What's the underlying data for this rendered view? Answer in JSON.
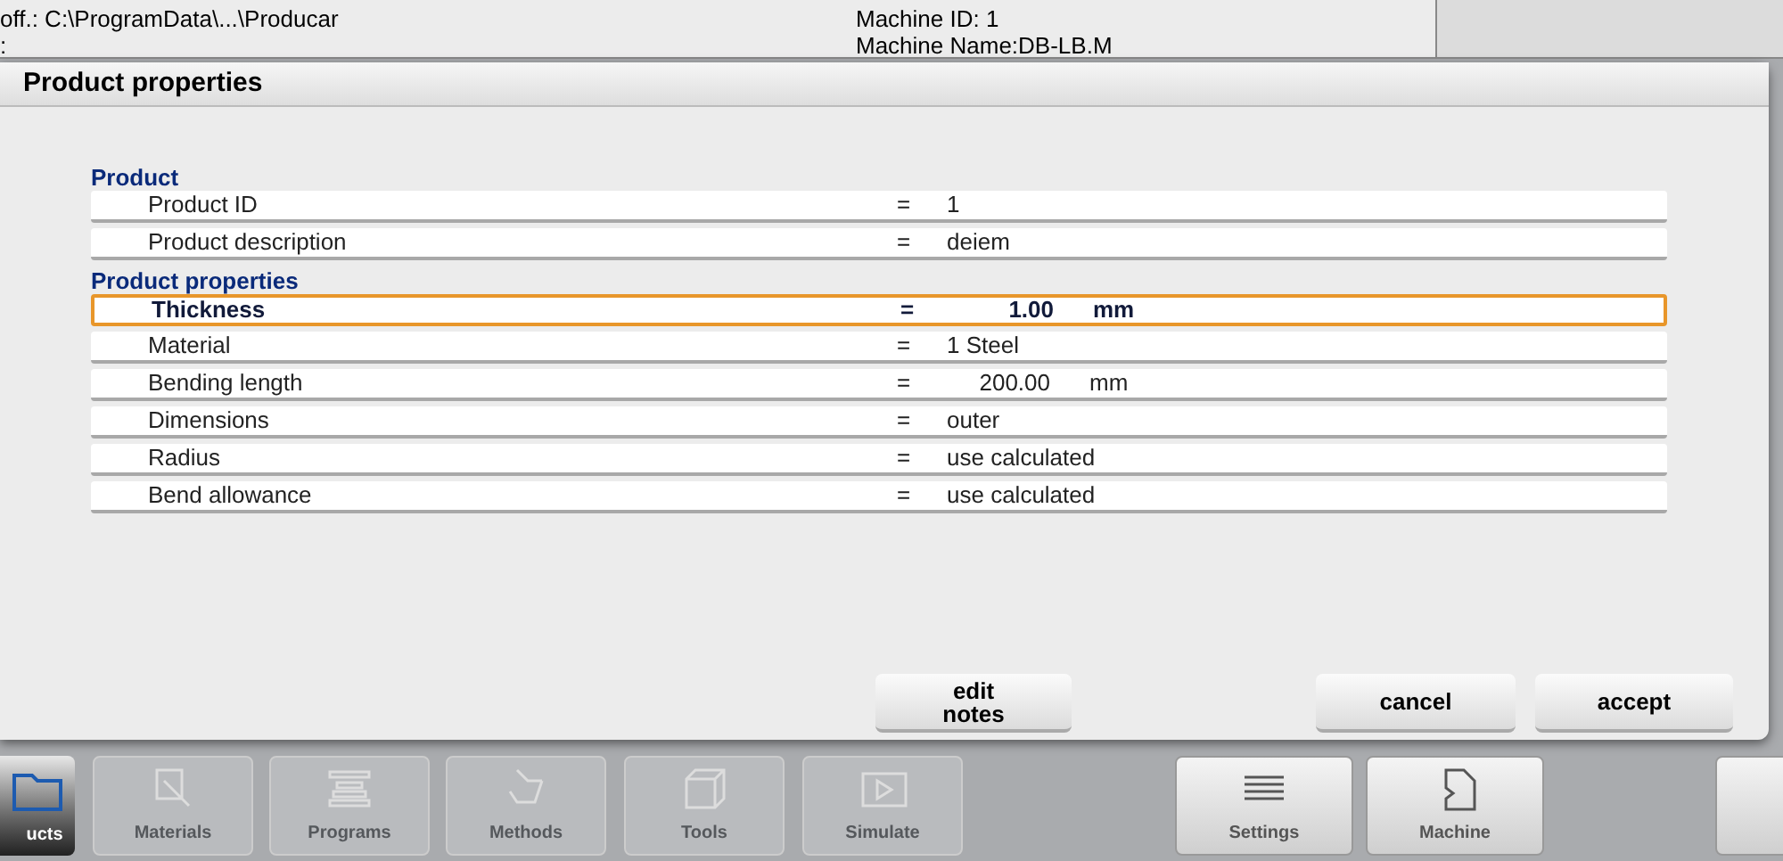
{
  "header": {
    "path": "off.: C:\\ProgramData\\...\\Producar",
    "line_2": ":",
    "machine_id": "Machine ID: 1",
    "machine_name": "Machine Name:DB-LB.M"
  },
  "dialog": {
    "title": "Product properties",
    "sections": [
      {
        "title": "Product",
        "rows": [
          {
            "label": "Product ID",
            "equals": "=",
            "value": "1",
            "kind": "text",
            "selected": false
          },
          {
            "label": "Product description",
            "equals": "=",
            "value": "deiem",
            "kind": "text",
            "selected": false
          }
        ]
      },
      {
        "title": "Product properties",
        "rows": [
          {
            "label": "Thickness",
            "equals": "=",
            "value": "1.00",
            "unit": "mm",
            "kind": "number",
            "selected": true
          },
          {
            "label": "Material",
            "equals": "=",
            "value": "1 Steel",
            "kind": "text",
            "selected": false
          },
          {
            "label": "Bending length",
            "equals": "=",
            "value": "200.00",
            "unit": "mm",
            "kind": "number",
            "selected": false
          },
          {
            "label": "Dimensions",
            "equals": "=",
            "value": "outer",
            "kind": "text",
            "selected": false
          },
          {
            "label": "Radius",
            "equals": "=",
            "value": "use calculated",
            "kind": "text",
            "selected": false
          },
          {
            "label": "Bend allowance",
            "equals": "=",
            "value": "use calculated",
            "kind": "text",
            "selected": false
          }
        ]
      }
    ],
    "buttons": [
      {
        "label": "edit notes",
        "kind": "notes"
      },
      {
        "label": "cancel",
        "kind": "action"
      },
      {
        "label": "accept",
        "kind": "action"
      }
    ]
  },
  "toolbar": [
    {
      "label": "ucts",
      "selected": true,
      "disabled": false
    },
    {
      "label": "Materials",
      "selected": false,
      "disabled": true
    },
    {
      "label": "Programs",
      "selected": false,
      "disabled": true
    },
    {
      "label": "Methods",
      "selected": false,
      "disabled": true
    },
    {
      "label": "Tools",
      "selected": false,
      "disabled": true
    },
    {
      "label": "Simulate",
      "selected": false,
      "disabled": true
    },
    {
      "label": "Settings",
      "selected": false,
      "disabled": false
    },
    {
      "label": "Machine",
      "selected": false,
      "disabled": false
    }
  ]
}
